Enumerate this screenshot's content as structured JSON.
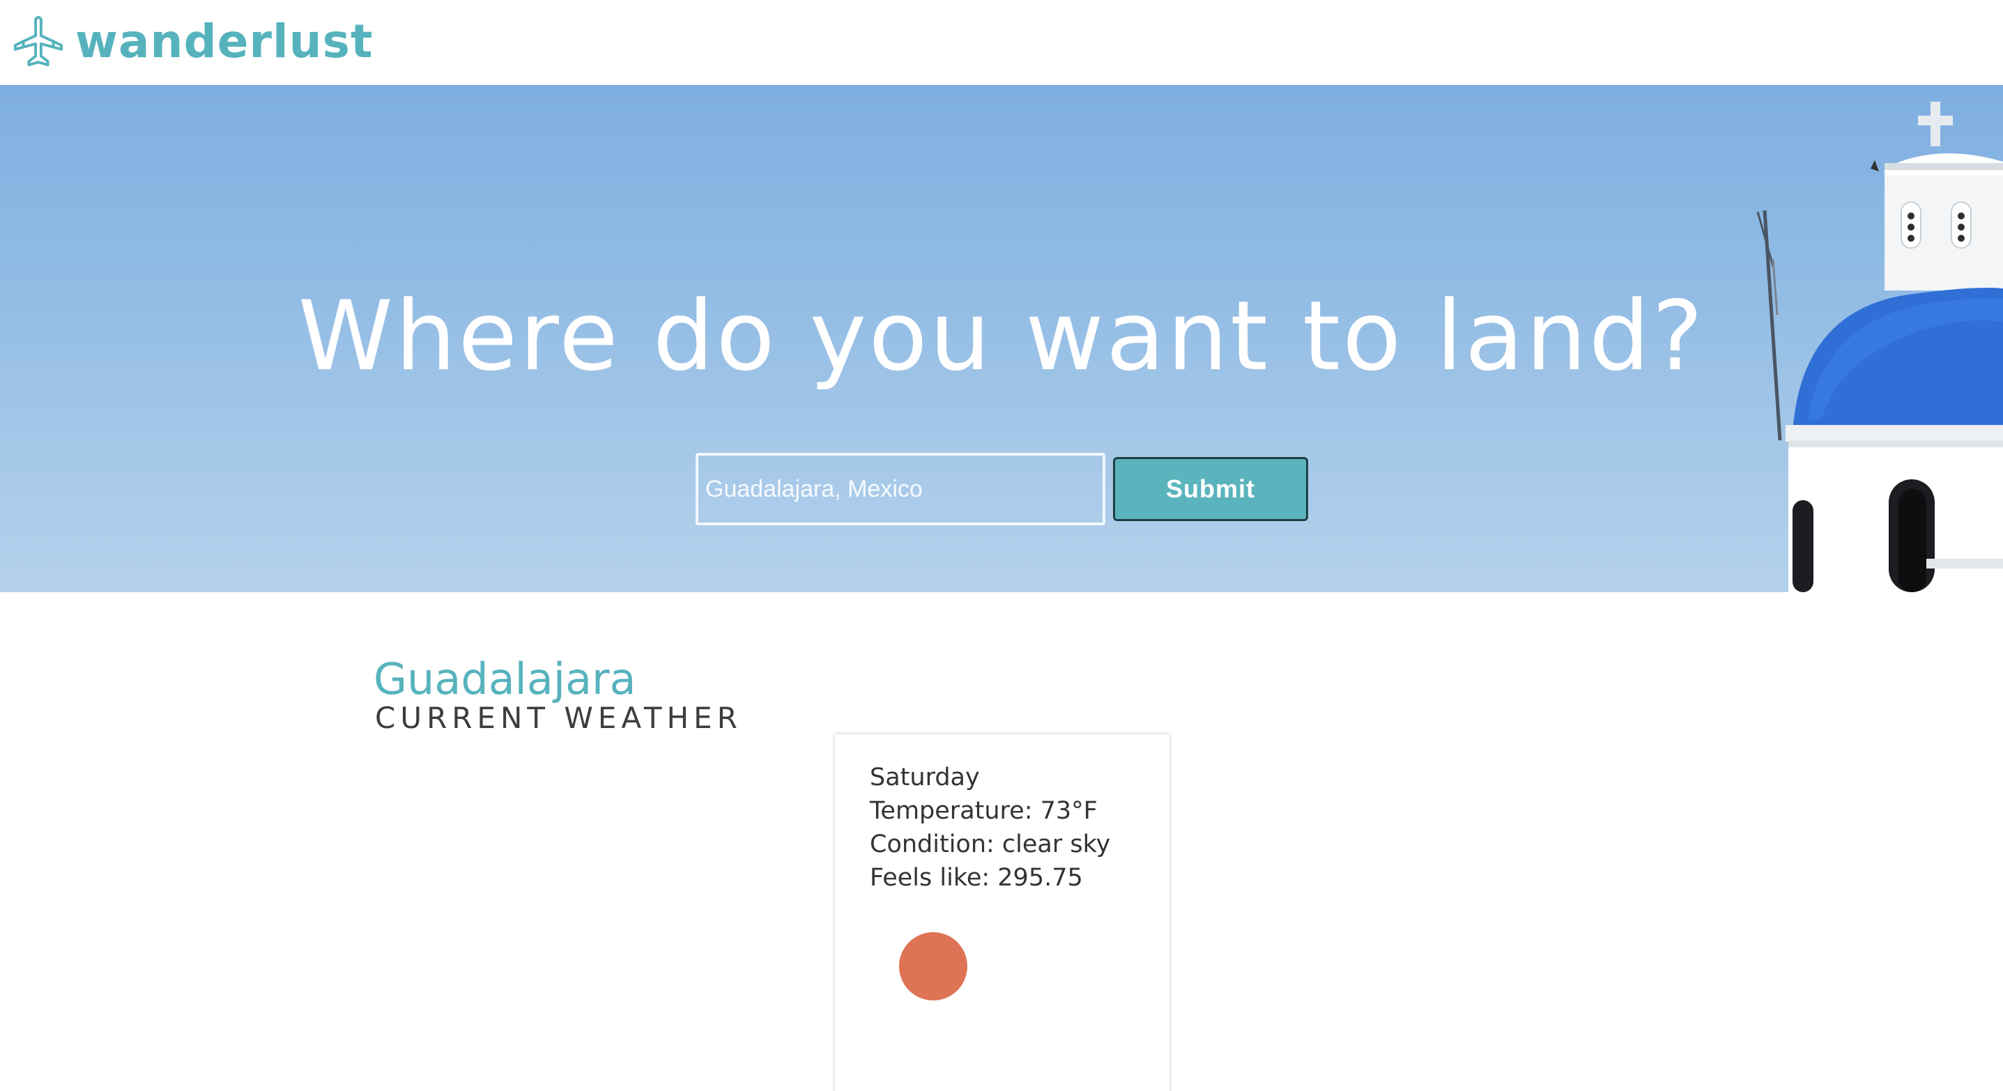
{
  "header": {
    "logo_text": "wanderlust",
    "logo_icon": "airplane-icon"
  },
  "hero": {
    "title": "Where do you want to land?",
    "search": {
      "placeholder": "Guadalajara, Mexico",
      "value": ""
    },
    "submit_label": "Submit"
  },
  "weather": {
    "city": "Guadalajara",
    "subtitle": "CURRENT WEATHER",
    "card": {
      "day": "Saturday",
      "temperature": "Temperature: 73°F",
      "condition": "Condition: clear sky",
      "feels_like": "Feels like: 295.75",
      "icon": "sun-icon"
    }
  },
  "colors": {
    "brand": "#56b3bd",
    "sun": "#de7355",
    "dome": "#2f6fd6"
  }
}
